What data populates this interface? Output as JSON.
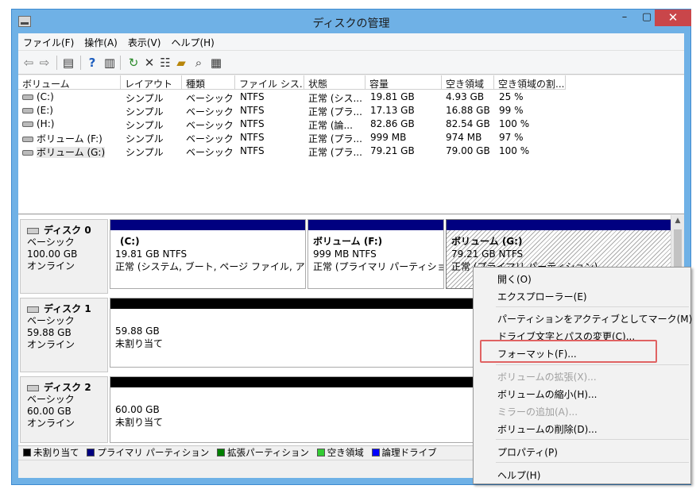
{
  "window": {
    "title": "ディスクの管理",
    "minimize": "–",
    "maximize": "▢",
    "close": "✕"
  },
  "menu": [
    "ファイル(F)",
    "操作(A)",
    "表示(V)",
    "ヘルプ(H)"
  ],
  "toolbar_icons": [
    "back-arrow-icon",
    "forward-arrow-icon",
    "console-tree-icon",
    "help-icon",
    "action-pane-icon",
    "refresh-icon",
    "delete-icon",
    "properties-icon",
    "open-folder-icon",
    "search-icon",
    "settings-icon"
  ],
  "volume_columns": [
    "ボリューム",
    "レイアウト",
    "種類",
    "ファイル シス...",
    "状態",
    "容量",
    "空き領域",
    "空き領域の割..."
  ],
  "volumes": [
    [
      "(C:)",
      "シンプル",
      "ベーシック",
      "NTFS",
      "正常 (シス...",
      "19.81 GB",
      "4.93 GB",
      "25 %"
    ],
    [
      "(E:)",
      "シンプル",
      "ベーシック",
      "NTFS",
      "正常 (プラ...",
      "17.13 GB",
      "16.88 GB",
      "99 %"
    ],
    [
      "(H:)",
      "シンプル",
      "ベーシック",
      "NTFS",
      "正常 (論...",
      "82.86 GB",
      "82.54 GB",
      "100 %"
    ],
    [
      "ボリューム (F:)",
      "シンプル",
      "ベーシック",
      "NTFS",
      "正常 (プラ...",
      "999 MB",
      "974 MB",
      "97 %"
    ],
    [
      "ボリューム (G:)",
      "シンプル",
      "ベーシック",
      "NTFS",
      "正常 (プラ...",
      "79.21 GB",
      "79.00 GB",
      "100 %"
    ]
  ],
  "disks": [
    {
      "name": "ディスク 0",
      "type": "ベーシック",
      "size": "100.00 GB",
      "status": "オンライン",
      "partitions": [
        {
          "name": "(C:)",
          "size": "19.81 GB NTFS",
          "status": "正常 (システム, ブート, ページ ファイル, アクティブ"
        },
        {
          "name": "ボリューム  (F:)",
          "size": "999 MB NTFS",
          "status": "正常 (プライマリ パーティション)"
        },
        {
          "name": "ボリューム  (G:)",
          "size": "79.21 GB NTFS",
          "status": "正常 (プライマリ パーティション)"
        }
      ]
    },
    {
      "name": "ディスク 1",
      "type": "ベーシック",
      "size": "59.88 GB",
      "status": "オンライン",
      "partitions": [
        {
          "size": "59.88 GB",
          "status": "未割り当て"
        }
      ]
    },
    {
      "name": "ディスク 2",
      "type": "ベーシック",
      "size": "60.00 GB",
      "status": "オンライン",
      "partitions": [
        {
          "size": "60.00 GB",
          "status": "未割り当て"
        }
      ]
    }
  ],
  "legend": [
    {
      "label": "未割り当て",
      "color": "#000000"
    },
    {
      "label": "プライマリ パーティション",
      "color": "#000080"
    },
    {
      "label": "拡張パーティション",
      "color": "#008000"
    },
    {
      "label": "空き領域",
      "color": "#33cc33"
    },
    {
      "label": "論理ドライブ",
      "color": "#0000ff"
    }
  ],
  "context_menu": {
    "open": "開く(O)",
    "explorer": "エクスプローラー(E)",
    "mark_active": "パーティションをアクティブとしてマーク(M)",
    "change_letter": "ドライブ文字とパスの変更(C)...",
    "format": "フォーマット(F)...",
    "extend": "ボリュームの拡張(X)...",
    "shrink": "ボリュームの縮小(H)...",
    "add_mirror": "ミラーの追加(A)...",
    "delete": "ボリュームの削除(D)...",
    "properties": "プロパティ(P)",
    "help": "ヘルプ(H)"
  },
  "colors": {
    "primary_partition": "#000080",
    "unallocated": "#000000",
    "highlight": "#e06363"
  }
}
